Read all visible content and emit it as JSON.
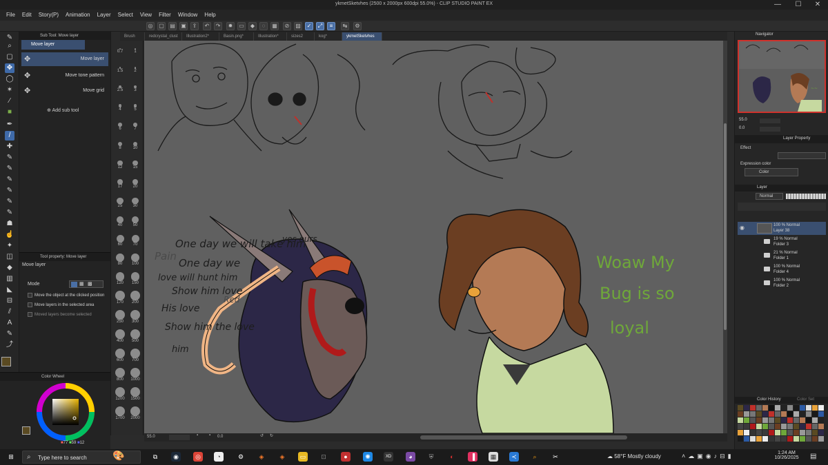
{
  "window": {
    "title": "ykmetSketvhes (2500 x 2000px 600dpi 55.0%) - CLIP STUDIO PAINT EX",
    "controls": [
      "—",
      "☐",
      "✕"
    ]
  },
  "menu": [
    "File",
    "Edit",
    "Story(P)",
    "Animation",
    "Layer",
    "Select",
    "View",
    "Filter",
    "Window",
    "Help"
  ],
  "subtool": {
    "panel_title": "Sub Tool: Move layer",
    "group_label": "Move layer",
    "items": [
      "Move layer",
      "Move tone pattern",
      "Move grid"
    ],
    "add_label": "Add sub tool"
  },
  "toolproperty": {
    "panel_title": "Tool property: Move layer",
    "name": "Move layer",
    "mode_label": "Mode",
    "options": [
      "Move the object at the clicked position",
      "Move layers in the selected area",
      "Moved layers become selected"
    ]
  },
  "brush_sizes": [
    "0.7",
    "1",
    "1.5",
    "2",
    "2.5",
    "3",
    "4",
    "5",
    "6",
    "7",
    "8",
    "10",
    "12",
    "15",
    "17",
    "20",
    "25",
    "30",
    "40",
    "50",
    "60",
    "70",
    "80",
    "100",
    "120",
    "150",
    "170",
    "200",
    "250",
    "300",
    "400",
    "500",
    "600",
    "700",
    "800",
    "1000",
    "1200",
    "1500",
    "1700",
    "2000"
  ],
  "color": {
    "panel_title": "Color Wheel",
    "h": "77",
    "s": "59",
    "v": "12",
    "main_color": "#5a4a22"
  },
  "tabs": [
    "Brush",
    "redcrystal_clust",
    "Illustration2*",
    "Basin.png*",
    "Illustration*",
    "sizes2",
    "kog*",
    "ykmetSketvhes"
  ],
  "canvas": {
    "text_left": [
      "One day we will take him",
      "yes ours",
      "Pain",
      "One day we",
      "love will hunt him",
      "Show him love",
      "His love",
      "Red",
      "Show him the love",
      "him"
    ],
    "text_right": [
      "Woaw My",
      "Bug is so",
      "loyal"
    ]
  },
  "status": {
    "zoom": "55.0",
    "angle": "0.0"
  },
  "navigator": {
    "title": "Navigator",
    "zoom": "55.0",
    "angle": "0.0"
  },
  "layerproperty": {
    "title": "Layer Property",
    "effect_label": "Effect",
    "expression_label": "Expression color",
    "expression_value": "Color"
  },
  "layers": {
    "title": "Layer",
    "blend_mode": "Normal",
    "opacity": "100",
    "items": [
      {
        "line1": "100 % Normal",
        "line2": "Layer 38",
        "type": "layer",
        "selected": true
      },
      {
        "line1": "19 % Normal",
        "line2": "Folder 3",
        "type": "folder",
        "selected": false
      },
      {
        "line1": "21 % Normal",
        "line2": "Folder 1",
        "type": "folder",
        "selected": false
      },
      {
        "line1": "100 % Normal",
        "line2": "Folder 4",
        "type": "folder",
        "selected": false
      },
      {
        "line1": "100 % Normal",
        "line2": "Folder 2",
        "type": "folder",
        "selected": false
      }
    ]
  },
  "colorhistory": {
    "title": "Color History",
    "title2": "Color Set"
  },
  "taskbar": {
    "search_placeholder": "Type here to search",
    "weather": "58°F  Mostly cloudy",
    "time": "1:24 AM",
    "date": "10/26/2025"
  }
}
